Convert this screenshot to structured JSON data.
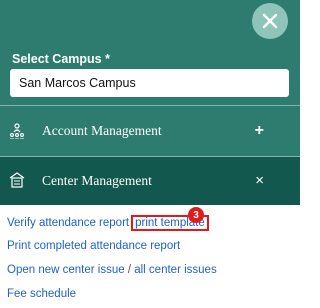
{
  "header": {
    "close_icon": "close-icon"
  },
  "campus": {
    "label": "Select Campus *",
    "value": "San Marcos Campus"
  },
  "menu": {
    "account": {
      "label": "Account Management",
      "toggle": "+",
      "icon": "org-chart-icon"
    },
    "center": {
      "label": "Center Management",
      "toggle": "×",
      "icon": "building-icon"
    }
  },
  "links": {
    "verify": "Verify attendance report",
    "print_template": "print template",
    "print_completed": "Print completed attendance report",
    "open_issue": "Open new center issue",
    "separator": "/",
    "all_issues": "all center issues",
    "fee_schedule": "Fee schedule"
  },
  "annotation": {
    "badge": "3"
  },
  "colors": {
    "primary": "#2e7b6f",
    "primary_dark": "#13584e",
    "close_bg": "#8fc4ba",
    "link": "#1d63c7",
    "highlight": "#e11b1b"
  }
}
